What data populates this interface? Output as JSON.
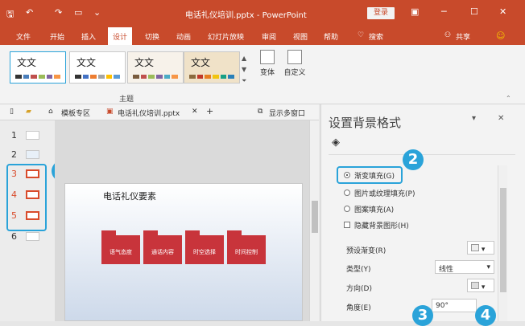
{
  "titlebar": {
    "title": "电话礼仪培训.pptx - PowerPoint",
    "login": "登录"
  },
  "tabs": [
    "文件",
    "开始",
    "插入",
    "设计",
    "切换",
    "动画",
    "幻灯片放映",
    "审阅",
    "视图",
    "帮助",
    "搜索",
    "共享"
  ],
  "active_tab": "设计",
  "ribbon": {
    "themes": [
      {
        "text": "文文",
        "colors": [
          "#333333",
          "#4a7ebb",
          "#c0504d",
          "#9bbb59",
          "#8064a2",
          "#f79646"
        ]
      },
      {
        "text": "文文",
        "colors": [
          "#333333",
          "#4472c4",
          "#ed7d31",
          "#a5a5a5",
          "#ffc000",
          "#5b9bd5"
        ]
      },
      {
        "text": "文文",
        "colors": [
          "#7a5c3e",
          "#c0504d",
          "#9bbb59",
          "#8064a2",
          "#4bacc6",
          "#f79646"
        ]
      },
      {
        "text": "文文",
        "colors": [
          "#8b6a3e",
          "#c0392b",
          "#e67e22",
          "#f1c40f",
          "#16a085",
          "#2980b9"
        ]
      }
    ],
    "group_label": "主题",
    "variant_label": "变体",
    "custom_label": "自定义"
  },
  "file_tabs": {
    "template_tab": "模板专区",
    "doc_tab": "电话礼仪培训.pptx",
    "multi_window": "显示多窗口"
  },
  "thumbnails": [
    {
      "num": "1",
      "selected": false
    },
    {
      "num": "2",
      "selected": false
    },
    {
      "num": "3",
      "selected": true
    },
    {
      "num": "4",
      "selected": true
    },
    {
      "num": "5",
      "selected": true
    },
    {
      "num": "6",
      "selected": false
    }
  ],
  "slide": {
    "title": "电话礼仪要素",
    "boxes": [
      "语气态度",
      "通话内容",
      "时空选择",
      "时间控制"
    ]
  },
  "pane": {
    "title": "设置背景格式",
    "fill_options": [
      {
        "label": "渐变填充(G)",
        "checked": true,
        "kind": "radio"
      },
      {
        "label": "图片或纹理填充(P)",
        "checked": false,
        "kind": "radio"
      },
      {
        "label": "图案填充(A)",
        "checked": false,
        "kind": "radio"
      },
      {
        "label": "隐藏背景图形(H)",
        "checked": false,
        "kind": "checkbox"
      }
    ],
    "preset_label": "预设渐变(R)",
    "type_label": "类型(Y)",
    "type_value": "线性",
    "direction_label": "方向(D)",
    "angle_label": "角度(E)",
    "angle_value": "90°"
  },
  "badges": [
    "1",
    "2",
    "3",
    "4"
  ],
  "colors": {
    "accent": "#c84a2b",
    "badge": "#2aa3d9",
    "slide_box": "#c8343b"
  }
}
